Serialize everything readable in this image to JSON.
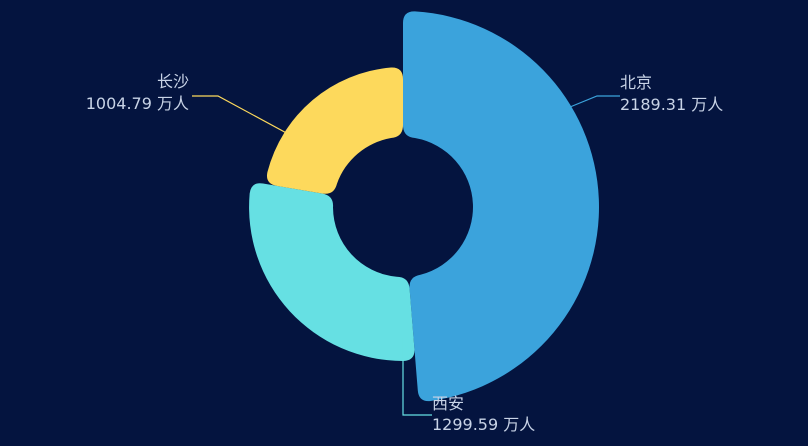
{
  "chart_data": {
    "type": "pie",
    "variant": "rose-donut",
    "unit": "万人",
    "slices": [
      {
        "name": "北京",
        "value": 2189.31,
        "color": "#3ba3dc"
      },
      {
        "name": "西安",
        "value": 1299.59,
        "color": "#66e0e3"
      },
      {
        "name": "长沙",
        "value": 1004.79,
        "color": "#fdd95c"
      }
    ],
    "label_color": "#c8d3e6",
    "background": "#04143f"
  }
}
